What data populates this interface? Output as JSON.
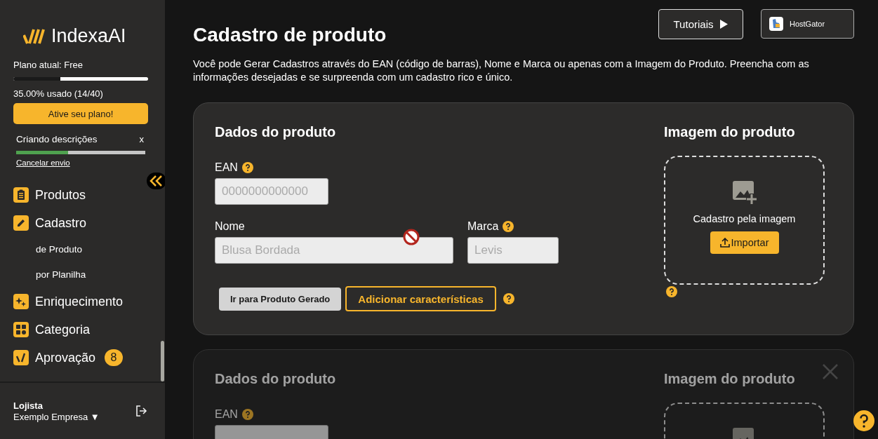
{
  "sidebar": {
    "logo": "IndexaAI",
    "plan_label": "Plano atual: Free",
    "plan_usage": {
      "level": 0.35
    },
    "usage_text": "35.00% usado (14/40)",
    "activate_button": "Ative seu plano!",
    "task": {
      "title": "Criando descrições",
      "close": "x",
      "level": 0.4,
      "cancel_link": "Cancelar envio"
    },
    "nav": [
      {
        "label": "Produtos"
      },
      {
        "label": "Cadastro",
        "children": [
          {
            "label": "de Produto"
          },
          {
            "label": "por Planilha"
          }
        ]
      },
      {
        "label": "Enriquecimento"
      },
      {
        "label": "Categoria"
      },
      {
        "label": "Aprovação",
        "badge": "8"
      }
    ],
    "user": {
      "role": "Lojista",
      "company": "Exemplo Empresa ▼"
    }
  },
  "header": {
    "title": "Cadastro de produto",
    "description": "Você pode Gerar Cadastros através do EAN (código de barras), Nome e Marca ou apenas com a Imagem do Produto. Preencha com as informações desejadas e se surpreenda com um cadastro rico e único.",
    "tutorials_button": "Tutoriais",
    "host_button": "HostGator"
  },
  "cards": [
    {
      "active": true,
      "closable": false,
      "data_title": "Dados do produto",
      "ean_label": "EAN",
      "ean_placeholder": "0000000000000",
      "name_label": "Nome",
      "name_placeholder": "Blusa Bordada",
      "brand_label": "Marca",
      "brand_placeholder": "Levis",
      "go_button": "Ir para Produto Gerado",
      "add_button": "Adicionar características",
      "image_title": "Imagem do produto",
      "image_caption": "Cadastro pela imagem",
      "import_button": "Importar"
    },
    {
      "active": false,
      "closable": true,
      "data_title": "Dados do produto",
      "ean_label": "EAN",
      "image_title": "Imagem do produto"
    }
  ]
}
